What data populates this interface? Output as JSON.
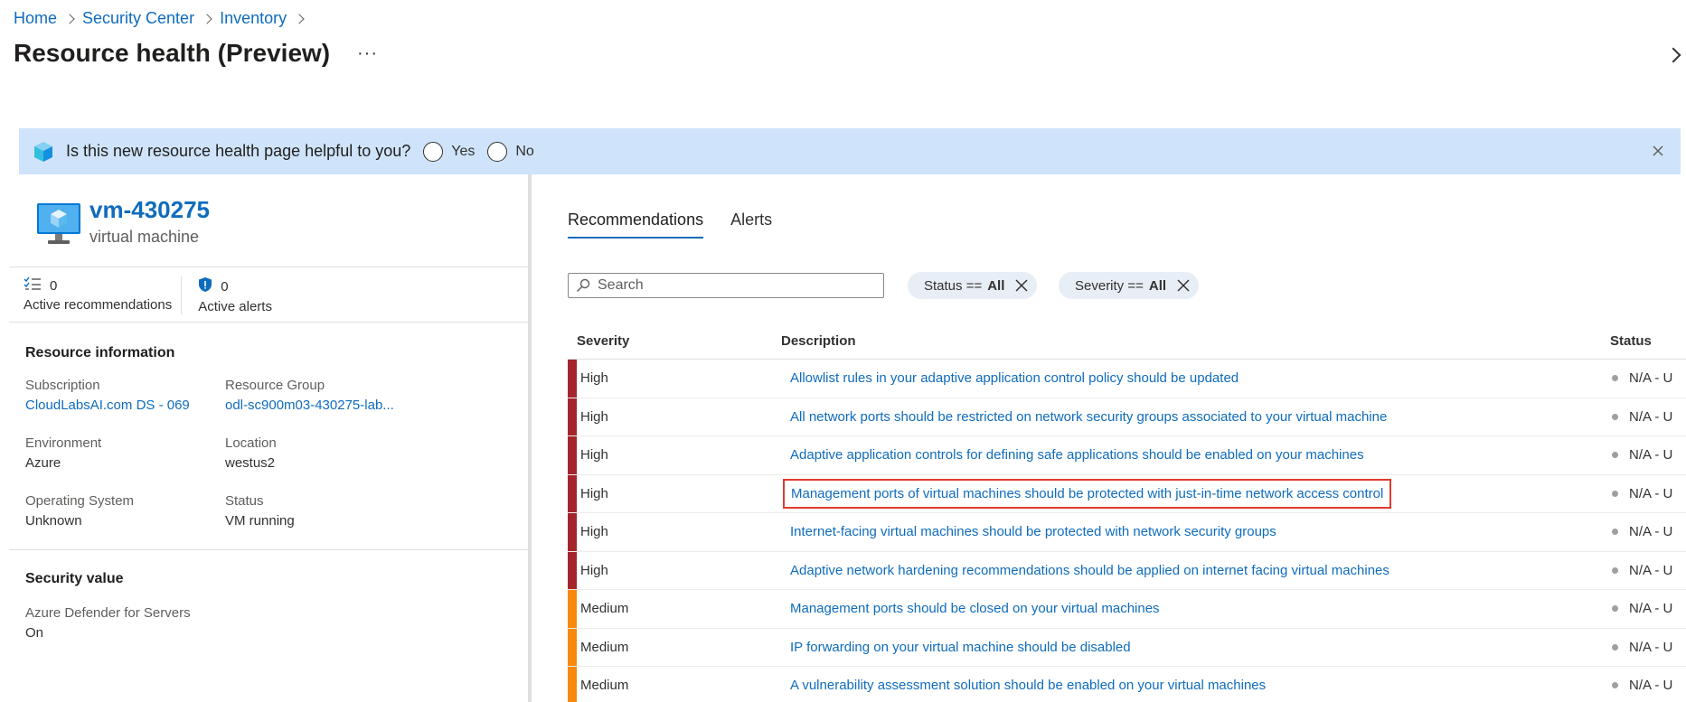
{
  "breadcrumb": [
    "Home",
    "Security Center",
    "Inventory"
  ],
  "page": {
    "title": "Resource health (Preview)",
    "more": "···"
  },
  "banner": {
    "question": "Is this new resource health page helpful to you?",
    "yes": "Yes",
    "no": "No"
  },
  "resource": {
    "name": "vm-430275",
    "type": "virtual machine",
    "active_recommendations_count": "0",
    "active_recommendations_label": "Active recommendations",
    "active_alerts_count": "0",
    "active_alerts_label": "Active alerts"
  },
  "resource_info": {
    "title": "Resource information",
    "subscription_label": "Subscription",
    "subscription_value": "CloudLabsAI.com DS - 069",
    "resource_group_label": "Resource Group",
    "resource_group_value": "odl-sc900m03-430275-lab...",
    "environment_label": "Environment",
    "environment_value": "Azure",
    "location_label": "Location",
    "location_value": "westus2",
    "os_label": "Operating System",
    "os_value": "Unknown",
    "status_label": "Status",
    "status_value": "VM running"
  },
  "security_value": {
    "title": "Security value",
    "defender_label": "Azure Defender for Servers",
    "defender_value": "On"
  },
  "tabs": [
    "Recommendations",
    "Alerts"
  ],
  "search": {
    "placeholder": "Search"
  },
  "filters": [
    {
      "label": "Status ==",
      "value": "All"
    },
    {
      "label": "Severity ==",
      "value": "All"
    }
  ],
  "table": {
    "headers": {
      "severity": "Severity",
      "description": "Description",
      "status": "Status"
    },
    "rows": [
      {
        "severity": "High",
        "description": "Allowlist rules in your adaptive application control policy should be updated",
        "status": "N/A - U"
      },
      {
        "severity": "High",
        "description": "All network ports should be restricted on network security groups associated to your virtual machine",
        "status": "N/A - U"
      },
      {
        "severity": "High",
        "description": "Adaptive application controls for defining safe applications should be enabled on your machines",
        "status": "N/A - U"
      },
      {
        "severity": "High",
        "description": "Management ports of virtual machines should be protected with just-in-time network access control",
        "status": "N/A - U"
      },
      {
        "severity": "High",
        "description": "Internet-facing virtual machines should be protected with network security groups",
        "status": "N/A - U"
      },
      {
        "severity": "High",
        "description": "Adaptive network hardening recommendations should be applied on internet facing virtual machines",
        "status": "N/A - U"
      },
      {
        "severity": "Medium",
        "description": "Management ports should be closed on your virtual machines",
        "status": "N/A - U"
      },
      {
        "severity": "Medium",
        "description": "IP forwarding on your virtual machine should be disabled",
        "status": "N/A - U"
      },
      {
        "severity": "Medium",
        "description": "A vulnerability assessment solution should be enabled on your virtual machines",
        "status": "N/A - U"
      }
    ]
  },
  "colors": {
    "high": "#a4262c",
    "medium": "#f7890e",
    "link": "#0f6cbd",
    "highlight": "#e03b2f",
    "banner": "#cfe4fa"
  }
}
